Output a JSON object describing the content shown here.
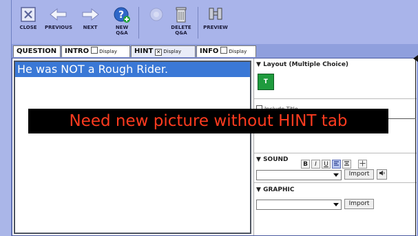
{
  "toolbar": {
    "buttons": [
      {
        "label": "CLOSE",
        "icon": "close-icon"
      },
      {
        "label": "PREVIOUS",
        "icon": "arrow-left-icon"
      },
      {
        "label": "NEXT",
        "icon": "arrow-right-icon"
      },
      {
        "label": "NEW\nQ&A",
        "icon": "new-qa-icon"
      },
      {
        "label": "",
        "icon": "disabled-icon"
      },
      {
        "label": "DELETE\nQ&A",
        "icon": "trash-icon"
      },
      {
        "label": "PREVIEW",
        "icon": "binoculars-icon"
      }
    ]
  },
  "tabs": [
    {
      "label": "QUESTION"
    },
    {
      "label": "INTRO",
      "display": "Display"
    },
    {
      "label": "HINT",
      "display": "Display"
    },
    {
      "label": "INFO",
      "display": "Display"
    }
  ],
  "editor": {
    "text": "He was NOT a Rough Rider."
  },
  "panel": {
    "layout_header": "Layout (Multiple Choice)",
    "layout_button": "T",
    "include_title": "Include Title",
    "format_buttons": [
      "B",
      "I",
      "U"
    ],
    "sound_header": "SOUND",
    "graphic_header": "GRAPHIC",
    "import_label": "Import"
  },
  "overlay_note": "Need new picture without HINT tab",
  "colors": {
    "toolbar": "#a9b4ea",
    "selection": "#3a78d6",
    "note_text": "#ff3b1f"
  }
}
